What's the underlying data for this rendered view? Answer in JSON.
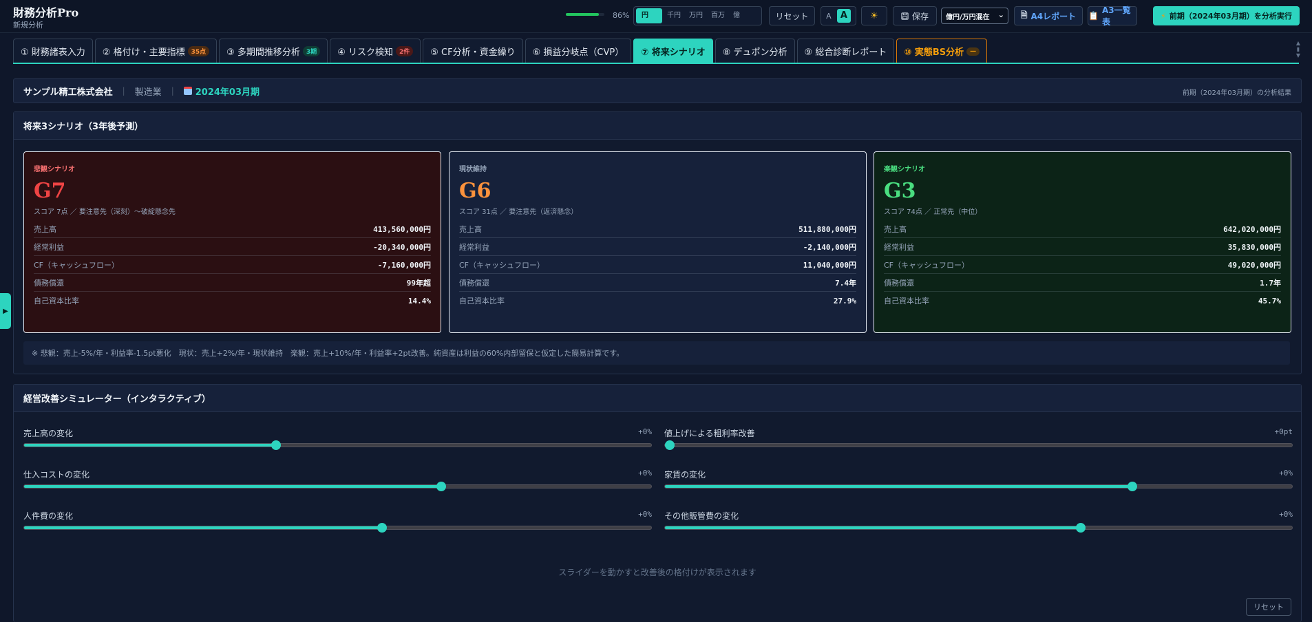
{
  "app": {
    "title": "財務分析Pro",
    "subtitle": "新規分析",
    "progress_text": "86%",
    "progress_fraction": 0.86
  },
  "toolbar": {
    "units": [
      "円",
      "千円",
      "万円",
      "百万",
      "億"
    ],
    "active_unit": "円",
    "reset_label": "リセット",
    "font_small": "A",
    "font_large": "A",
    "save_label": "保存",
    "unit_select_value": "億円/万円混在",
    "a4_label": "A4レポート",
    "a3_label": "A3一覧表",
    "run_label": "前期（2024年03月期）を分析実行"
  },
  "tabs": [
    {
      "label": "① 財務諸表入力",
      "badge": ""
    },
    {
      "label": "② 格付け・主要指標",
      "badge": "35点"
    },
    {
      "label": "③ 多期間推移分析",
      "badge": "3期"
    },
    {
      "label": "④ リスク検知",
      "badge": "2件"
    },
    {
      "label": "⑤ CF分析・資金繰り",
      "badge": ""
    },
    {
      "label": "⑥ 損益分岐点（CVP）",
      "badge": ""
    },
    {
      "label": "⑦ 将来シナリオ",
      "badge": ""
    },
    {
      "label": "⑧ デュポン分析",
      "badge": ""
    },
    {
      "label": "⑨ 総合診断レポート",
      "badge": ""
    },
    {
      "label": "⑩ 実態BS分析",
      "badge": "—"
    }
  ],
  "company": {
    "name": "サンプル精工株式会社",
    "industry": "製造業",
    "period": "2024年03月期",
    "note": "前期（2024年03月期）の分析結果"
  },
  "scenario": {
    "title": "将来3シナリオ（3年後予測）",
    "cards": [
      {
        "label": "悲観シナリオ",
        "grade": "G7",
        "score": "スコア 7点 ／ 要注意先（深刻）〜破綻懸念先",
        "metrics": [
          [
            "売上高",
            "413,560,000円"
          ],
          [
            "経常利益",
            "-20,340,000円"
          ],
          [
            "CF（キャッシュフロー）",
            "-7,160,000円"
          ],
          [
            "債務償還",
            "99年超"
          ],
          [
            "自己資本比率",
            "14.4%"
          ]
        ]
      },
      {
        "label": "現状維持",
        "grade": "G6",
        "score": "スコア 31点 ／ 要注意先（返済懸念）",
        "metrics": [
          [
            "売上高",
            "511,880,000円"
          ],
          [
            "経常利益",
            "-2,140,000円"
          ],
          [
            "CF（キャッシュフロー）",
            "11,040,000円"
          ],
          [
            "債務償還",
            "7.4年"
          ],
          [
            "自己資本比率",
            "27.9%"
          ]
        ]
      },
      {
        "label": "楽観シナリオ",
        "grade": "G3",
        "score": "スコア 74点 ／ 正常先（中位）",
        "metrics": [
          [
            "売上高",
            "642,020,000円"
          ],
          [
            "経常利益",
            "35,830,000円"
          ],
          [
            "CF（キャッシュフロー）",
            "49,020,000円"
          ],
          [
            "債務償還",
            "1.7年"
          ],
          [
            "自己資本比率",
            "45.7%"
          ]
        ]
      }
    ],
    "note": "※ 悲観：売上-5%/年・利益率-1.5pt悪化　現状：売上+2%/年・現状維持　楽観：売上+10%/年・利益率+2pt改善。純資産は利益の60%内部留保と仮定した簡易計算です。"
  },
  "simulator": {
    "title": "経営改善シミュレーター（インタラクティブ）",
    "sliders": [
      {
        "label": "売上高の変化",
        "value": "+0%",
        "fraction": 0.402
      },
      {
        "label": "値上げによる粗利率改善",
        "value": "+0pt",
        "fraction": 0.0
      },
      {
        "label": "仕入コストの変化",
        "value": "+0%",
        "fraction": 0.665
      },
      {
        "label": "家賃の変化",
        "value": "+0%",
        "fraction": 0.745
      },
      {
        "label": "人件費の変化",
        "value": "+0%",
        "fraction": 0.571
      },
      {
        "label": "その他販管費の変化",
        "value": "+0%",
        "fraction": 0.663
      }
    ],
    "hint": "スライダーを動かすと改善後の格付けが表示されます",
    "reset_label": "リセット"
  },
  "side_toggle_icon": "▶"
}
